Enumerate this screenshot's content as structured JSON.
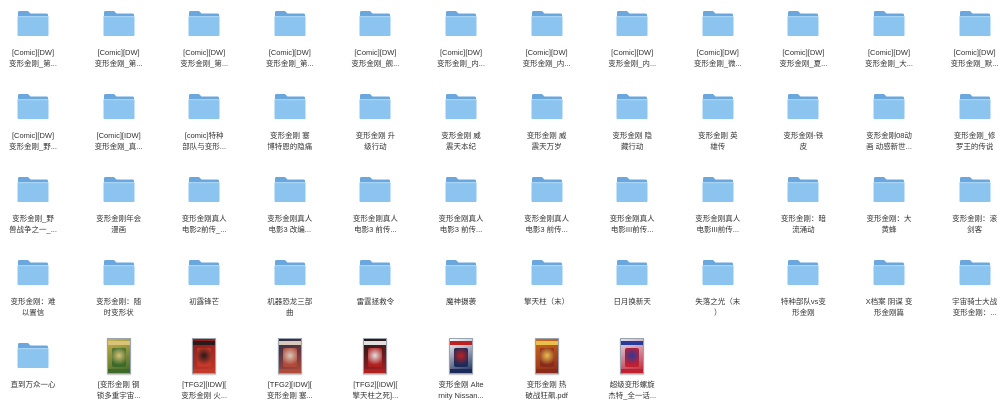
{
  "items": [
    {
      "type": "folder",
      "label": "[Comic][DW]\n变形金刚_第..."
    },
    {
      "type": "folder",
      "label": "[Comic][DW]\n变形金刚_第..."
    },
    {
      "type": "folder",
      "label": "[Comic][DW]\n变形金刚_第..."
    },
    {
      "type": "folder",
      "label": "[Comic][DW]\n变形金刚_第..."
    },
    {
      "type": "folder",
      "label": "[Comic][DW]\n变形金刚_舰..."
    },
    {
      "type": "folder",
      "label": "[Comic][DW]\n变形金刚_内..."
    },
    {
      "type": "folder",
      "label": "[Comic][DW]\n变形金刚_内..."
    },
    {
      "type": "folder",
      "label": "[Comic][DW]\n变形金刚_内..."
    },
    {
      "type": "folder",
      "label": "[Comic][DW]\n变形金刚_微..."
    },
    {
      "type": "folder",
      "label": "[Comic][DW]\n变形金刚_夏..."
    },
    {
      "type": "folder",
      "label": "[Comic][DW]\n变形金刚_大..."
    },
    {
      "type": "folder",
      "label": "[Comic][DW]\n变形金刚_默..."
    },
    {
      "type": "folder",
      "label": "[Comic][DW]\n变形金刚_野..."
    },
    {
      "type": "folder",
      "label": "[Comic][IDW]\n变形金刚_真..."
    },
    {
      "type": "folder",
      "label": "[comic]特种\n部队与变形..."
    },
    {
      "type": "folder",
      "label": "变形金刚 塞\n博特恩的隐痛"
    },
    {
      "type": "folder",
      "label": "变形金刚 升\n级行动"
    },
    {
      "type": "folder",
      "label": "变形金刚 威\n震天本纪"
    },
    {
      "type": "folder",
      "label": "变形金刚 威\n震天万岁"
    },
    {
      "type": "folder",
      "label": "变形金刚 隐\n藏行动"
    },
    {
      "type": "folder",
      "label": "变形金刚 英\n雄传"
    },
    {
      "type": "folder",
      "label": "变形金刚-铁\n皮"
    },
    {
      "type": "folder",
      "label": "变形金刚08动\n画 动感新世..."
    },
    {
      "type": "folder",
      "label": "变形金刚_修\n罗王的传说"
    },
    {
      "type": "folder",
      "label": "变形金刚_野\n兽战争之一_..."
    },
    {
      "type": "folder",
      "label": "变形金刚年会\n漫画"
    },
    {
      "type": "folder",
      "label": "变形金刚真人\n电影2前传_..."
    },
    {
      "type": "folder",
      "label": "变形金刚真人\n电影3 改编..."
    },
    {
      "type": "folder",
      "label": "变形金刚真人\n电影3 前传..."
    },
    {
      "type": "folder",
      "label": "变形金刚真人\n电影3 前传..."
    },
    {
      "type": "folder",
      "label": "变形金刚真人\n电影3 前传..."
    },
    {
      "type": "folder",
      "label": "变形金刚真人\n电影III前传..."
    },
    {
      "type": "folder",
      "label": "变形金刚真人\n电影III前传..."
    },
    {
      "type": "folder",
      "label": "变形金刚：暗\n流涌动"
    },
    {
      "type": "folder",
      "label": "变形金刚：大\n黄蜂"
    },
    {
      "type": "folder",
      "label": "变形金刚：滚\n剑客"
    },
    {
      "type": "folder",
      "label": "变形金刚：难\n以置信"
    },
    {
      "type": "folder",
      "label": "变形金刚：随\n时变形状"
    },
    {
      "type": "folder",
      "label": "初露锋芒"
    },
    {
      "type": "folder",
      "label": "机器恐龙三部\n曲"
    },
    {
      "type": "folder",
      "label": "雷霆拯救令"
    },
    {
      "type": "folder",
      "label": "魔神摄袭"
    },
    {
      "type": "folder",
      "label": "擎天柱（末）"
    },
    {
      "type": "folder",
      "label": "日月换新天"
    },
    {
      "type": "folder",
      "label": "失落之光（末\n）"
    },
    {
      "type": "folder",
      "label": "特种部队vs变\n形金刚"
    },
    {
      "type": "folder",
      "label": "X档案 阴谋 变\n形金刚篇"
    },
    {
      "type": "folder",
      "label": "宇宙骑士大战\n变形金刚：..."
    },
    {
      "type": "folder",
      "label": "直到万众一心"
    },
    {
      "type": "pdf",
      "label": "[变形金刚 钢\n锁多重宇宙...",
      "colors": [
        "#c9b24a",
        "#3d6a2a",
        "#d9c27a"
      ]
    },
    {
      "type": "pdf",
      "label": "[TFG2][IDW][\n变形金刚 火...",
      "colors": [
        "#8a1a1a",
        "#c43a2a",
        "#2a1a1a"
      ]
    },
    {
      "type": "pdf",
      "label": "[TFG2][IDW][\n变形金刚 塞...",
      "colors": [
        "#2a2a4a",
        "#b04a3a",
        "#d8c8b8"
      ]
    },
    {
      "type": "pdf",
      "label": "[TFG2][IDW][\n擎天柱之死]...",
      "colors": [
        "#1a1a1a",
        "#b02020",
        "#e0e0e0"
      ]
    },
    {
      "type": "pdf",
      "label": "变形金刚 Alte\nrnity Nissan...",
      "colors": [
        "#ffffff",
        "#1a2a5a",
        "#c02020"
      ]
    },
    {
      "type": "pdf",
      "label": "变形金刚 热\n破战狂飙.pdf",
      "colors": [
        "#d06a1a",
        "#8a2a1a",
        "#e8c050"
      ]
    },
    {
      "type": "pdf",
      "label": "超级变形螺旋\n杰特_全一话...",
      "colors": [
        "#e0e0f0",
        "#c02030",
        "#2a3a9a"
      ]
    }
  ]
}
